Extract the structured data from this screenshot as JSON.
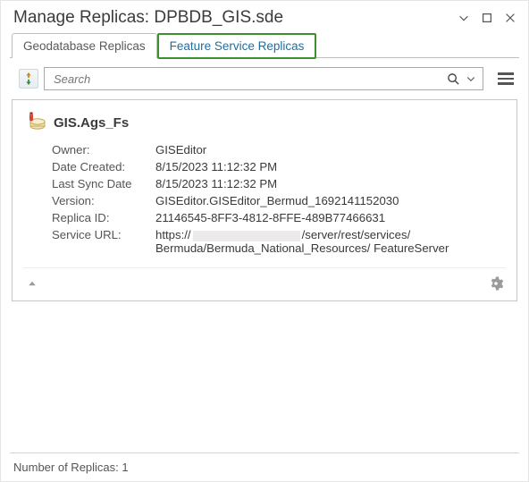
{
  "window": {
    "title": "Manage Replicas: DPBDB_GIS.sde"
  },
  "tabs": {
    "geodatabase": "Geodatabase Replicas",
    "feature_service": "Feature Service Replicas"
  },
  "search": {
    "placeholder": "Search"
  },
  "replica": {
    "name": "GIS.Ags_Fs",
    "fields": {
      "owner_label": "Owner:",
      "owner_value": "GISEditor",
      "date_created_label": "Date Created:",
      "date_created_value": "8/15/2023 11:12:32 PM",
      "last_sync_label": "Last Sync Date",
      "last_sync_value": "8/15/2023 11:12:32 PM",
      "version_label": "Version:",
      "version_value": "GISEditor.GISEditor_Bermud_1692141152030",
      "replica_id_label": "Replica ID:",
      "replica_id_value": "21146545-8FF3-4812-8FFE-489B77466631",
      "service_url_label": "Service URL:",
      "service_url_prefix": "https://",
      "service_url_suffix": "/server/rest/services/ Bermuda/Bermuda_National_Resources/ FeatureServer"
    }
  },
  "status": {
    "count_label": "Number of Replicas: 1"
  }
}
